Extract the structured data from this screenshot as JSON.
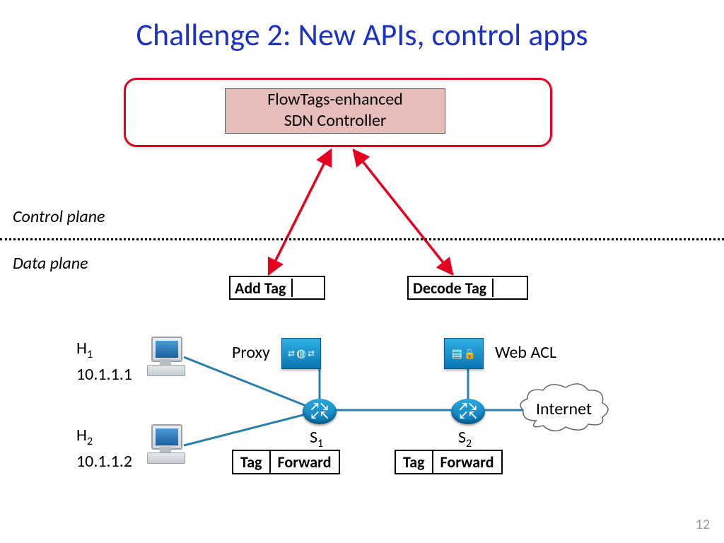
{
  "title": "Challenge 2: New APIs, control apps",
  "controller": {
    "line1": "FlowTags-enhanced",
    "line2": "SDN Controller"
  },
  "planes": {
    "control": "Control plane",
    "data": "Data plane"
  },
  "boxes": {
    "add_tag": "Add Tag",
    "decode_tag": "Decode Tag"
  },
  "hosts": {
    "h1": {
      "name": "H",
      "sub": "1",
      "ip": "10.1.1.1"
    },
    "h2": {
      "name": "H",
      "sub": "2",
      "ip": "10.1.1.2"
    }
  },
  "middleboxes": {
    "proxy": "Proxy",
    "webacl": "Web ACL"
  },
  "switches": {
    "s1": {
      "name": "S",
      "sub": "1"
    },
    "s2": {
      "name": "S",
      "sub": "2"
    }
  },
  "table": {
    "col1": "Tag",
    "col2": "Forward"
  },
  "internet": "Internet",
  "page": "12"
}
